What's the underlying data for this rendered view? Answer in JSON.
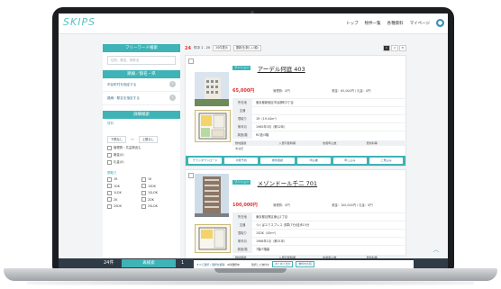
{
  "header": {
    "logo": "SKIPS",
    "nav": [
      "トップ",
      "物件一覧",
      "各種資料",
      "マイページ"
    ],
    "avatar_icon": "user-icon"
  },
  "sidebar": {
    "free_search_title": "フリーワード検索",
    "free_search_placeholder": "住所、駅名、物件名",
    "route_title": "路線／駅名・県",
    "route_items": [
      "市区町村を指定する",
      "路線・駅名を指定する"
    ],
    "detail_title": "詳細検索",
    "rent_label": "賃料",
    "rent_min": "下限なし",
    "rent_tilde": "〜",
    "rent_max": "上限なし",
    "checks": [
      "管理費・共益費含む",
      "敷金(0)",
      "礼金(0)"
    ],
    "layout_label": "間取り",
    "layouts": [
      "1R",
      "1K",
      "1DK",
      "1SDK",
      "1LDK",
      "1SLDK",
      "2K",
      "2DK",
      "2SDK",
      "2SLDK"
    ]
  },
  "toolbar": {
    "count": "24",
    "count_suffix": "件中 1 - 20",
    "per_page": "20件表示",
    "sort": "更新日(新しい順)",
    "pages": [
      "1",
      "2",
      "≫"
    ]
  },
  "cards": [
    {
      "badge": "マンション",
      "title": "アーデル何庭 403",
      "price": "65,000円",
      "fee": "管理費：0円",
      "deposit": "敷金：65,000円 / 礼金：0円",
      "rows": [
        {
          "k": "所在地",
          "v": "東京都新宿区市谷柳町3丁目"
        },
        {
          "k": "交通",
          "v": ""
        },
        {
          "k": "間取り",
          "v": "1R（19.44m²）"
        },
        {
          "k": "築年月",
          "v": "1985年3月（築32年）"
        },
        {
          "k": "構造/階",
          "v": "RC造/3階"
        }
      ],
      "sub_head": [
        "敷地面積",
        "入居可能時期",
        "他者申込数",
        "更新料等"
      ],
      "sub_vals": [
        "未決定",
        "",
        "",
        ""
      ],
      "actions": [
        "チラシダウンロード",
        "内見予約",
        "物件確認",
        "申込書",
        "申し込み",
        "ご見込み"
      ]
    },
    {
      "badge": "マンション",
      "title": "メゾンドール千二 701",
      "price": "100,000円",
      "fee": "管理費：0円",
      "deposit": "敷金：100,000円 / 礼金：0円",
      "rows": [
        {
          "k": "所在地",
          "v": "東京都目黒区東山2丁目"
        },
        {
          "k": "交通",
          "v": "つくばエクスプレス 浅草(7分)徒歩15分"
        },
        {
          "k": "間取り",
          "v": "1SDK（45m²）"
        },
        {
          "k": "築年月",
          "v": "1986年1月（築31年）"
        },
        {
          "k": "構造/階",
          "v": "7階/7階建"
        }
      ],
      "sub_head": [
        "敷地面積",
        "入居可能時期",
        "他者申込数",
        "更新料等"
      ],
      "sub_vals": [
        "",
        "",
        "",
        ""
      ],
      "actions": [
        "チラシダウンロード",
        "内見予約",
        "物件確認",
        "申込書",
        "申し込み",
        "ご見込み"
      ]
    }
  ],
  "footer": {
    "count": "24件",
    "search_button": "再検索",
    "num": "1",
    "select_all": "すべて選択 / 選択を解除",
    "selected": "0件選択中",
    "bulk_label": "選択した物件を",
    "btn_download": "まとめて出力",
    "btn_compare": "物件を比較"
  },
  "colors": {
    "accent": "#3fb3b5",
    "price": "#dd3333",
    "footer": "#2f3b46"
  }
}
